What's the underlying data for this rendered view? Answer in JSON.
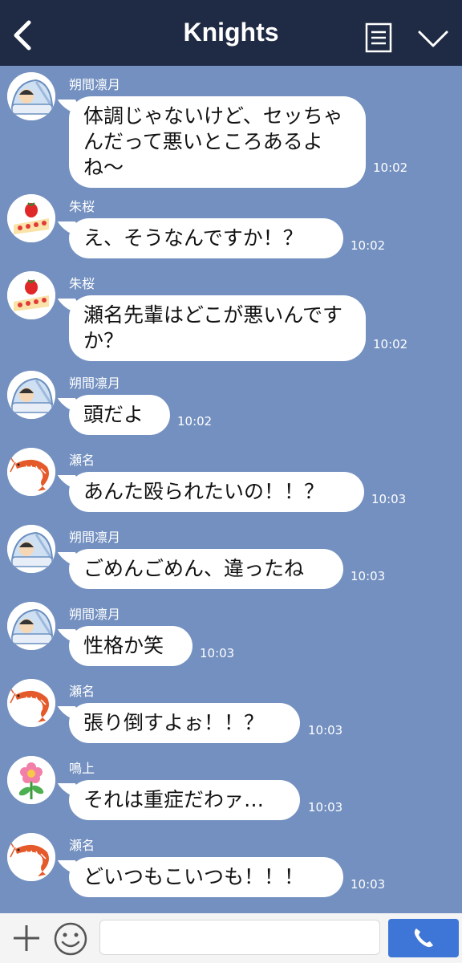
{
  "header": {
    "title": "Knights"
  },
  "messages": [
    {
      "sender": "朔間凛月",
      "text": "体調じゃないけど、セッちゃんだって悪いところあるよね〜",
      "time": "10:02"
    },
    {
      "sender": "朱桜",
      "text": "え、そうなんですか！？",
      "time": "10:02"
    },
    {
      "sender": "朱桜",
      "text": "瀬名先輩はどこが悪いんですか？",
      "time": "10:02"
    },
    {
      "sender": "朔間凛月",
      "text": "頭だよ",
      "time": "10:02"
    },
    {
      "sender": "瀬名",
      "text": "あんた殴られたいの！！？",
      "time": "10:03"
    },
    {
      "sender": "朔間凛月",
      "text": "ごめんごめん、違ったね",
      "time": "10:03"
    },
    {
      "sender": "朔間凛月",
      "text": "性格か笑",
      "time": "10:03"
    },
    {
      "sender": "瀬名",
      "text": "張り倒すよぉ！！？",
      "time": "10:03"
    },
    {
      "sender": "鳴上",
      "text": "それは重症だわァ…",
      "time": "10:03"
    },
    {
      "sender": "瀬名",
      "text": "どいつもこいつも！！！",
      "time": "10:03"
    }
  ],
  "input": {
    "value": ""
  },
  "icons": {
    "back": "chevron-left-icon",
    "menu": "menu-icon",
    "collapse": "chevron-down-icon",
    "plus": "plus-icon",
    "emoji": "smiley-icon",
    "call": "phone-icon",
    "avatar_ritsu": "sleeping-in-futon-icon",
    "avatar_tsukasa": "strawberry-shortcake-icon",
    "avatar_izumi": "shrimp-icon",
    "avatar_arashi": "flower-icon"
  },
  "colors": {
    "header_bg": "#1f2a44",
    "chat_bg": "#7390c0",
    "bubble_bg": "#ffffff",
    "call_button": "#3d76d6"
  }
}
